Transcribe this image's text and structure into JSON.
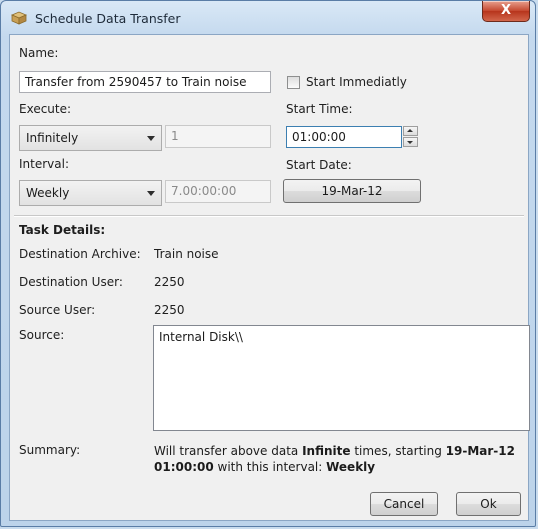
{
  "window": {
    "title": "Schedule Data Transfer",
    "close_glyph": "X"
  },
  "form": {
    "name_label": "Name:",
    "name_value": "Transfer from 2590457 to Train noise",
    "start_immediately_label": "Start Immediatly",
    "start_immediately_checked": false,
    "execute_label": "Execute:",
    "execute_selected": "Infinitely",
    "execute_count": "1",
    "start_time_label": "Start Time:",
    "start_time_value": "01:00:00",
    "interval_label": "Interval:",
    "interval_selected": "Weekly",
    "interval_value": "7.00:00:00",
    "start_date_label": "Start Date:",
    "start_date_value": "19-Mar-12"
  },
  "task_details": {
    "heading": "Task Details:",
    "destination_archive_label": "Destination Archive:",
    "destination_archive_value": "Train noise",
    "destination_user_label": "Destination User:",
    "destination_user_value": "2250",
    "source_user_label": "Source User:",
    "source_user_value": "2250",
    "source_label": "Source:",
    "source_value": "Internal Disk\\\\"
  },
  "summary": {
    "label": "Summary:",
    "part1": "Will transfer above data ",
    "times_value": "Infinite",
    "part2": " times, starting ",
    "date_value": "19-Mar-12",
    "time_value": "01:00:00",
    "part3": " with this interval: ",
    "interval_value": "Weekly"
  },
  "buttons": {
    "cancel": "Cancel",
    "ok": "Ok"
  },
  "icons": {
    "app": "box-icon",
    "close": "close-icon",
    "dropdown": "chevron-down-icon",
    "spin_up": "spin-up-icon",
    "spin_down": "spin-down-icon"
  }
}
